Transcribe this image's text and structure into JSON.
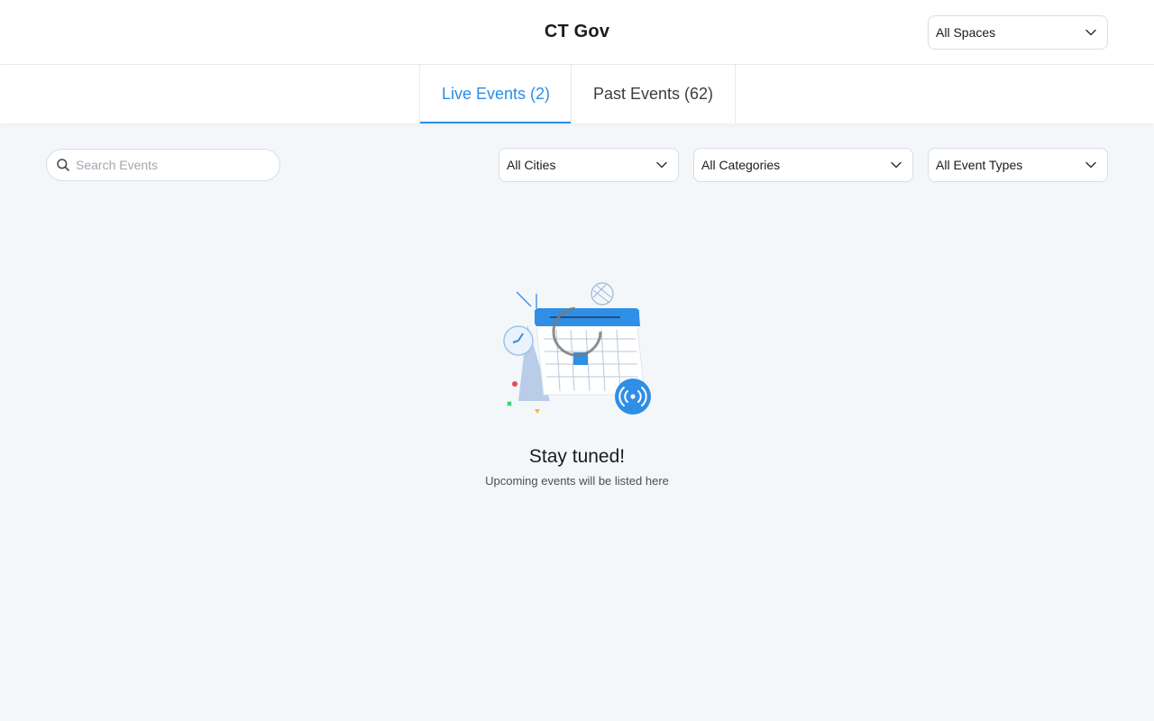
{
  "header": {
    "brand": "CT Gov",
    "spaces_select": {
      "value": "All Spaces"
    }
  },
  "tabs": [
    {
      "label": "Live Events (2)",
      "active": true
    },
    {
      "label": "Past Events (62)",
      "active": false
    }
  ],
  "filters": {
    "search": {
      "placeholder": "Search Events",
      "value": ""
    },
    "cities": {
      "value": "All Cities"
    },
    "categories": {
      "value": "All Categories"
    },
    "event_types": {
      "value": "All Event Types"
    }
  },
  "empty_state": {
    "title": "Stay tuned!",
    "subtitle": "Upcoming events will be listed here",
    "illustration_icon": "calendar-live-icon"
  },
  "colors": {
    "accent": "#2b8ee8",
    "background": "#f4f7fa",
    "surface": "#ffffff",
    "border": "#d9dde3"
  }
}
